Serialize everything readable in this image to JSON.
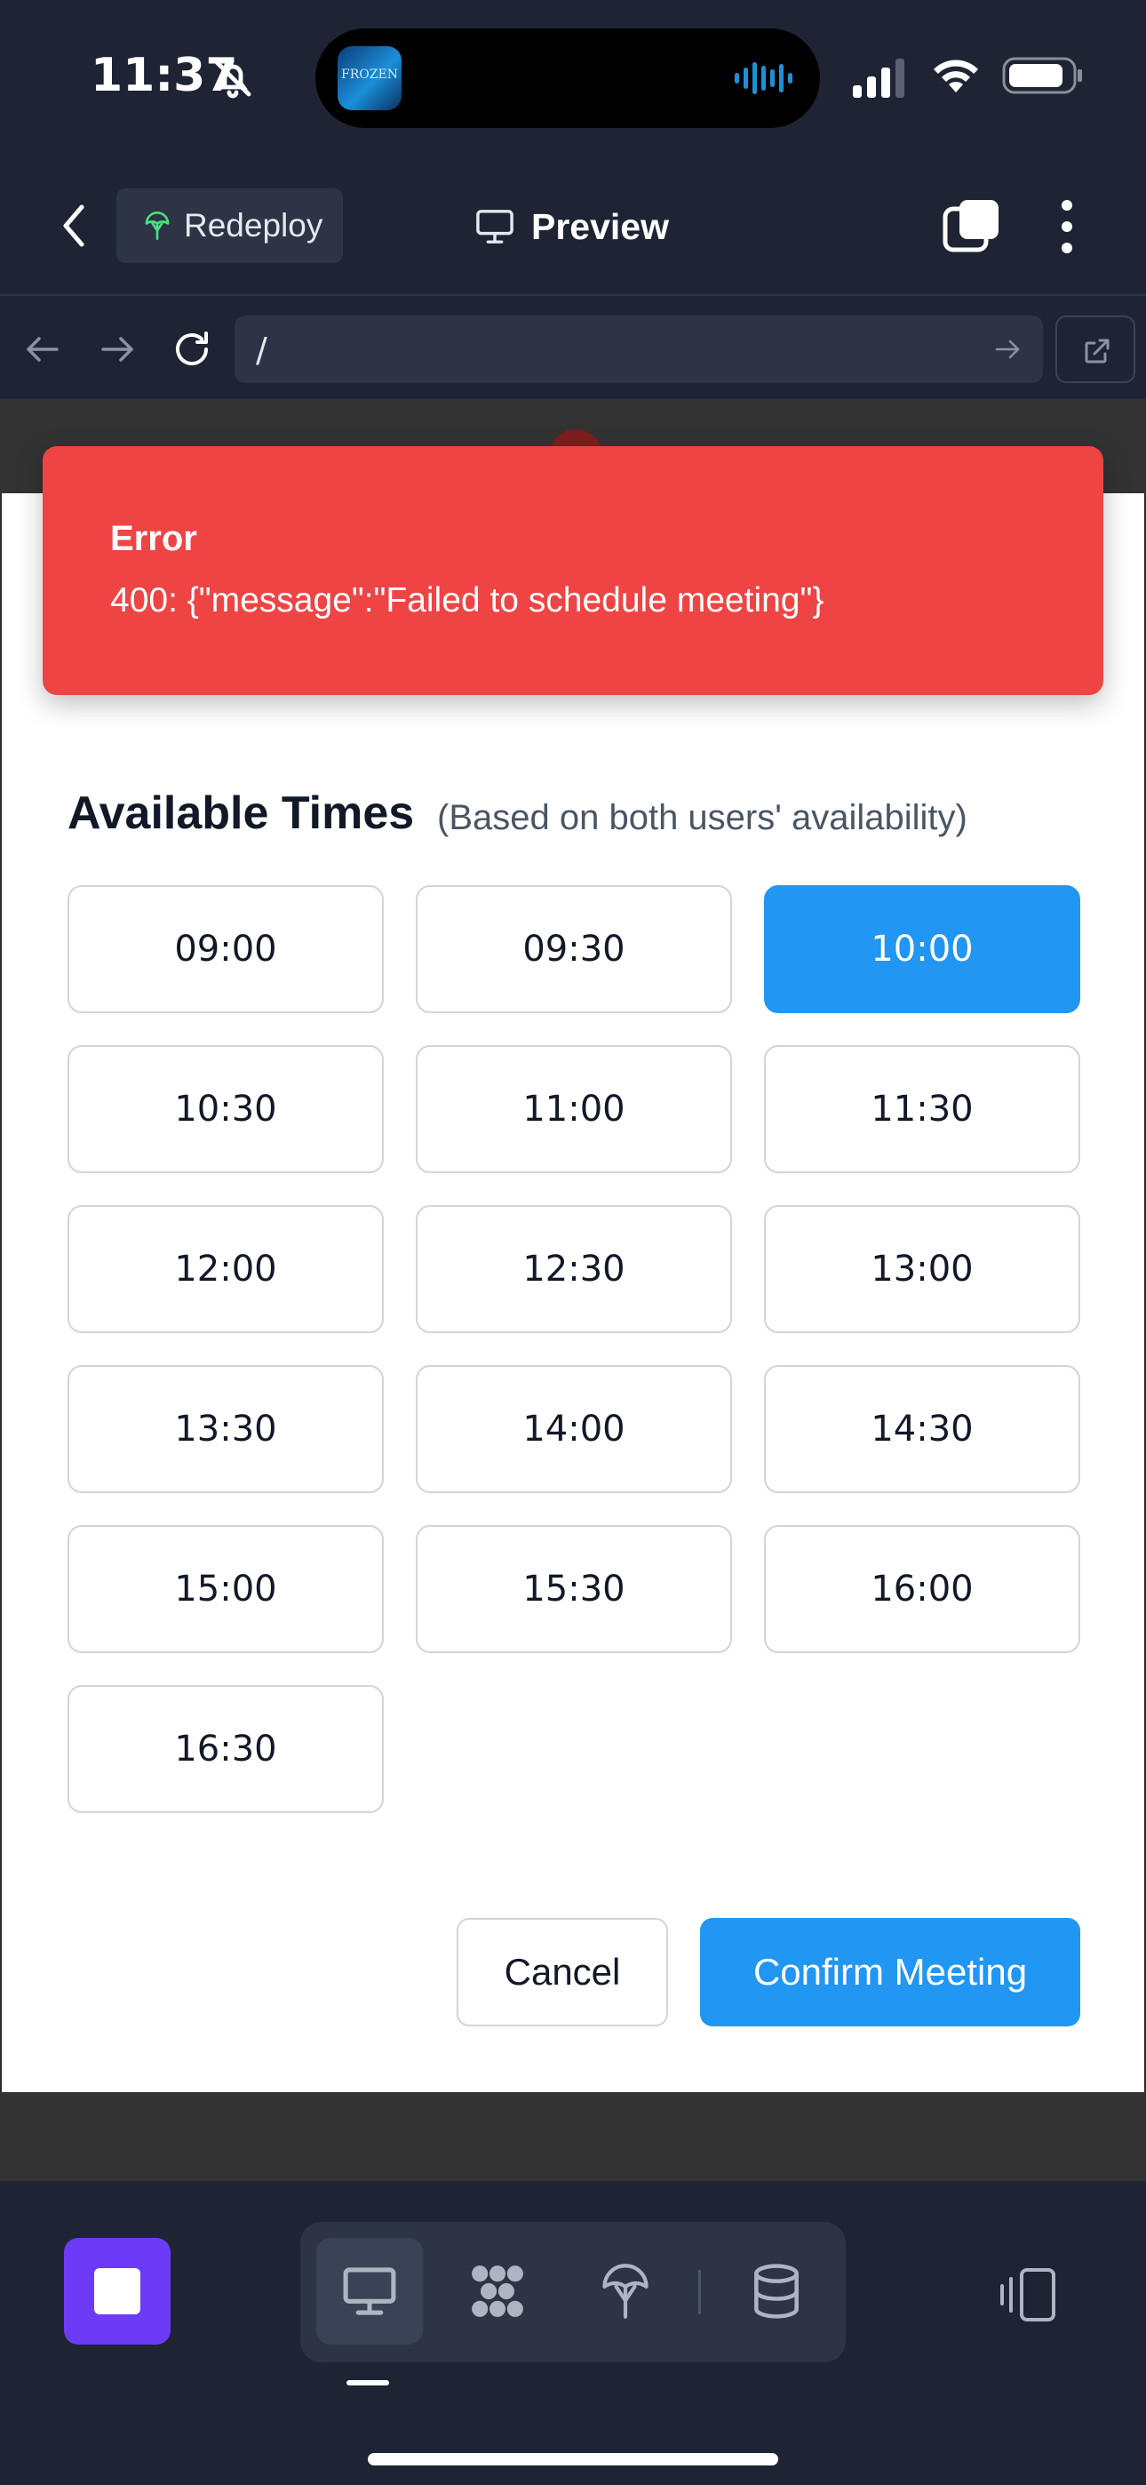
{
  "status_bar": {
    "time": "11:37",
    "island_thumb_text": "FROZEN"
  },
  "header": {
    "redeploy_label": "Redeploy",
    "title": "Preview"
  },
  "browser": {
    "url": "/"
  },
  "error_toast": {
    "title": "Error",
    "message": "400: {\"message\":\"Failed to schedule meeting\"}",
    "color": "#ef4444"
  },
  "available_times": {
    "title": "Available Times",
    "subtitle": "(Based on both users' availability)",
    "selected": "10:00",
    "slots": [
      "09:00",
      "09:30",
      "10:00",
      "10:30",
      "11:00",
      "11:30",
      "12:00",
      "12:30",
      "13:00",
      "13:30",
      "14:00",
      "14:30",
      "15:00",
      "15:30",
      "16:00",
      "16:30"
    ]
  },
  "actions": {
    "cancel_label": "Cancel",
    "confirm_label": "Confirm Meeting"
  },
  "colors": {
    "accent": "#2196f3",
    "dock_stop": "#6d3bf5",
    "background": "#1e2433"
  },
  "dock": {
    "tools": [
      "desktop-icon",
      "apps-icon",
      "deploy-icon",
      "database-icon"
    ],
    "active_tool": "desktop-icon"
  }
}
